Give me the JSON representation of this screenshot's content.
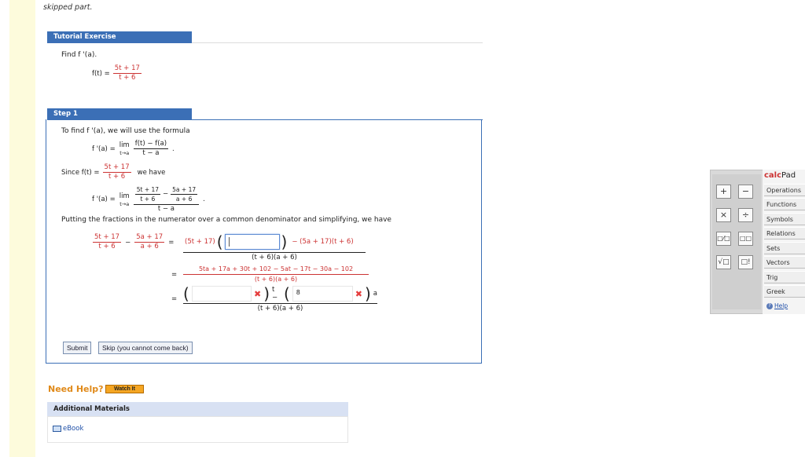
{
  "page": {
    "skipped_text": "skipped part."
  },
  "tutorial": {
    "header": "Tutorial Exercise",
    "find_text": "Find f '(a).",
    "f_lhs": "f(t) =",
    "f_num": "5t + 17",
    "f_den": "t + 6"
  },
  "step1": {
    "header": "Step 1",
    "intro": "To find  f '(a),  we will use the formula",
    "formula_lhs": "f '(a) =",
    "lim": "lim",
    "lim_sub": "t→a",
    "formula_num": "f(t) − f(a)",
    "formula_den": "t − a",
    "since_label": "Since  f(t) =",
    "since_num": "5t + 17",
    "since_den": "t + 6",
    "since_tail": "we have",
    "fp2_lhs": "f '(a) =",
    "inner1_num": "5t + 17",
    "inner1_den": "t + 6",
    "inner2_num": "5a + 17",
    "inner2_den": "a + 6",
    "outer_den": "t − a",
    "putting_text": "Putting the fractions in the numerator over a common denominator and simplifying, we have",
    "eq1_left_num": "5t + 17",
    "eq1_left_den": "t + 6",
    "eq1_right_num": "5a + 17",
    "eq1_right_den": "a + 6",
    "eq1_num_prefix": "(5t + 17)",
    "eq1_num_suffix": "− (5a + 17)(t + 6)",
    "eq1_den": "(t + 6)(a + 6)",
    "eq2_num": "5ta + 17a + 30t + 102 − 5at − 17t − 30a − 102",
    "eq2_den": "(t + 6)(a + 6)",
    "eq3_input1_value": "",
    "eq3_mid": "t −",
    "eq3_input2_value": "8",
    "eq3_tail": "a",
    "eq3_den": "(t + 6)(a + 6)",
    "submit_label": "Submit",
    "skip_label": "Skip (you cannot come back)"
  },
  "help": {
    "need_help": "Need Help?",
    "watch_label": "Watch It",
    "additional_materials": "Additional Materials",
    "ebook_label": "eBook"
  },
  "calcpad": {
    "title_calc": "calc",
    "title_pad": "Pad",
    "keys": [
      "+",
      "−",
      "×",
      "÷",
      "□⁄□",
      "□□",
      "√□",
      "□!"
    ],
    "categories": [
      "Operations",
      "Functions",
      "Symbols",
      "Relations",
      "Sets",
      "Vectors",
      "Trig",
      "Greek"
    ],
    "help_label": "Help"
  },
  "colors": {
    "header_blue": "#3b6fb6",
    "math_red": "#c33",
    "stripe_yellow": "#fdfbdc",
    "help_orange": "#e08a1a"
  }
}
